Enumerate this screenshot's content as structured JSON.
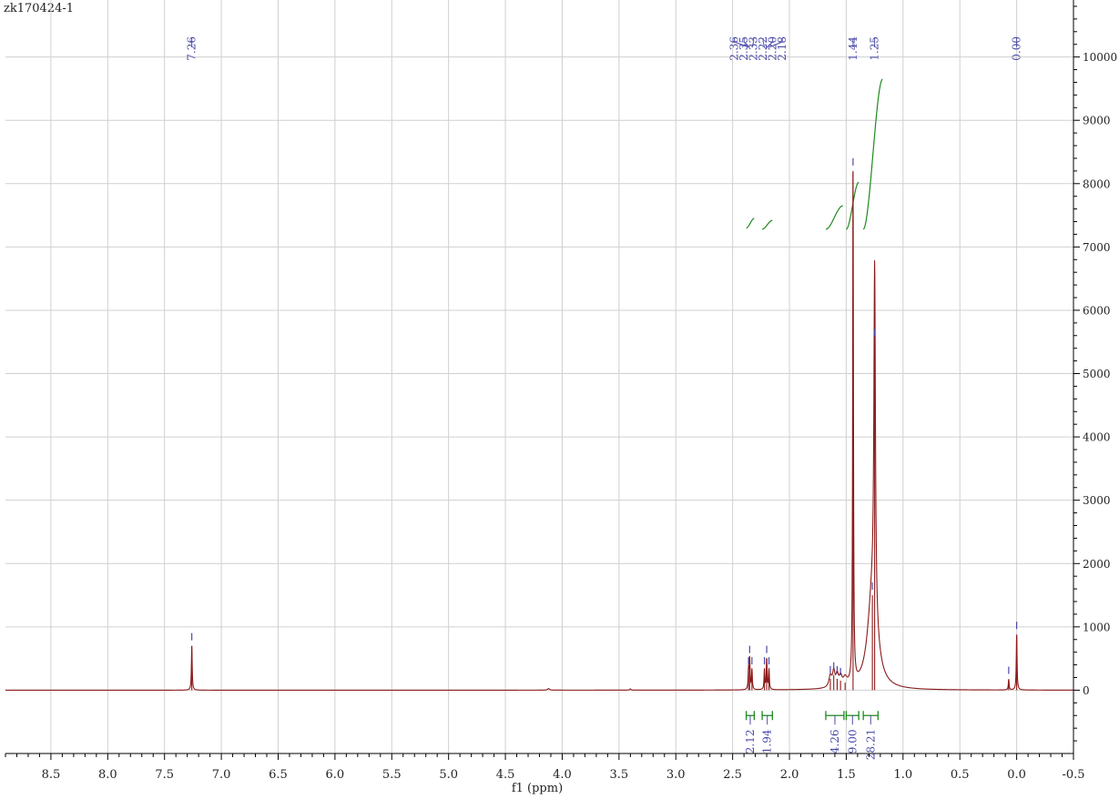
{
  "sample_id": "zk170424-1",
  "chart_data": {
    "type": "line",
    "title": "",
    "xlabel": "f1 (ppm)",
    "ylabel": "",
    "xlim": [
      8.9,
      -0.5
    ],
    "ylim": [
      -1000,
      10900
    ],
    "x_reversed": true,
    "grid": true,
    "x_ticks": [
      8.5,
      8.0,
      7.5,
      7.0,
      6.5,
      6.0,
      5.5,
      5.0,
      4.5,
      4.0,
      3.5,
      3.0,
      2.5,
      2.0,
      1.5,
      1.0,
      0.5,
      0.0,
      -0.5
    ],
    "x_tick_labels": [
      "8.5",
      "8.0",
      "7.5",
      "7.0",
      "6.5",
      "6.0",
      "5.5",
      "5.0",
      "4.5",
      "4.0",
      "3.5",
      "3.0",
      "2.5",
      "2.0",
      "1.5",
      "1.0",
      "0.5",
      "0.0",
      "-0.5"
    ],
    "y_ticks": [
      0,
      1000,
      2000,
      3000,
      4000,
      5000,
      6000,
      7000,
      8000,
      9000,
      10000
    ],
    "y_tick_labels": [
      "0",
      "1000",
      "2000",
      "3000",
      "4000",
      "5000",
      "6000",
      "7000",
      "8000",
      "9000",
      "10000"
    ],
    "series": [
      {
        "color": "#8b1a1a",
        "peaks": [
          {
            "x": 7.26,
            "h": 700,
            "w": 0.004
          },
          {
            "x": 4.12,
            "h": 25,
            "w": 0.01
          },
          {
            "x": 3.4,
            "h": 20,
            "w": 0.006
          },
          {
            "x": 2.36,
            "h": 320,
            "w": 0.004
          },
          {
            "x": 2.35,
            "h": 500,
            "w": 0.004
          },
          {
            "x": 2.33,
            "h": 320,
            "w": 0.004
          },
          {
            "x": 2.22,
            "h": 320,
            "w": 0.004
          },
          {
            "x": 2.2,
            "h": 500,
            "w": 0.004
          },
          {
            "x": 2.18,
            "h": 320,
            "w": 0.004
          },
          {
            "x": 1.64,
            "h": 180,
            "w": 0.015
          },
          {
            "x": 1.61,
            "h": 240,
            "w": 0.012
          },
          {
            "x": 1.58,
            "h": 180,
            "w": 0.012
          },
          {
            "x": 1.55,
            "h": 150,
            "w": 0.015
          },
          {
            "x": 1.51,
            "h": 120,
            "w": 0.02
          },
          {
            "x": 1.44,
            "h": 8200,
            "w": 0.004
          },
          {
            "x": 1.27,
            "h": 1500,
            "w": 0.05
          },
          {
            "x": 1.25,
            "h": 5500,
            "w": 0.008
          },
          {
            "x": 0.07,
            "h": 170,
            "w": 0.004
          },
          {
            "x": 0.0,
            "h": 880,
            "w": 0.004
          }
        ]
      }
    ],
    "peak_labels": [
      "7.26",
      "2.36",
      "2.35",
      "2.33",
      "2.22",
      "2.20",
      "2.18",
      "1.44",
      "1.25",
      "0.00"
    ],
    "integral_curves": [
      {
        "x_from": 2.38,
        "x_to": 2.31,
        "y_from": 7300,
        "y_to": 7450
      },
      {
        "x_from": 2.24,
        "x_to": 2.15,
        "y_from": 7280,
        "y_to": 7420
      },
      {
        "x_from": 1.68,
        "x_to": 1.53,
        "y_from": 7280,
        "y_to": 7650
      },
      {
        "x_from": 1.5,
        "x_to": 1.39,
        "y_from": 7280,
        "y_to": 8020
      },
      {
        "x_from": 1.35,
        "x_to": 1.18,
        "y_from": 7280,
        "y_to": 9650
      }
    ],
    "integrals": [
      {
        "label": "2.12",
        "from": 2.38,
        "to": 2.31
      },
      {
        "label": "1.94",
        "from": 2.24,
        "to": 2.15
      },
      {
        "label": "4.26",
        "from": 1.68,
        "to": 1.52
      },
      {
        "label": "9.00",
        "from": 1.5,
        "to": 1.39
      },
      {
        "label": "28.21",
        "from": 1.35,
        "to": 1.22
      }
    ],
    "colors": {
      "spectrum": "#8b1a1a",
      "integral": "#1e8a1e",
      "label": "#4a4aa8",
      "axis": "#000000",
      "grid": "#d0d0d0"
    }
  }
}
